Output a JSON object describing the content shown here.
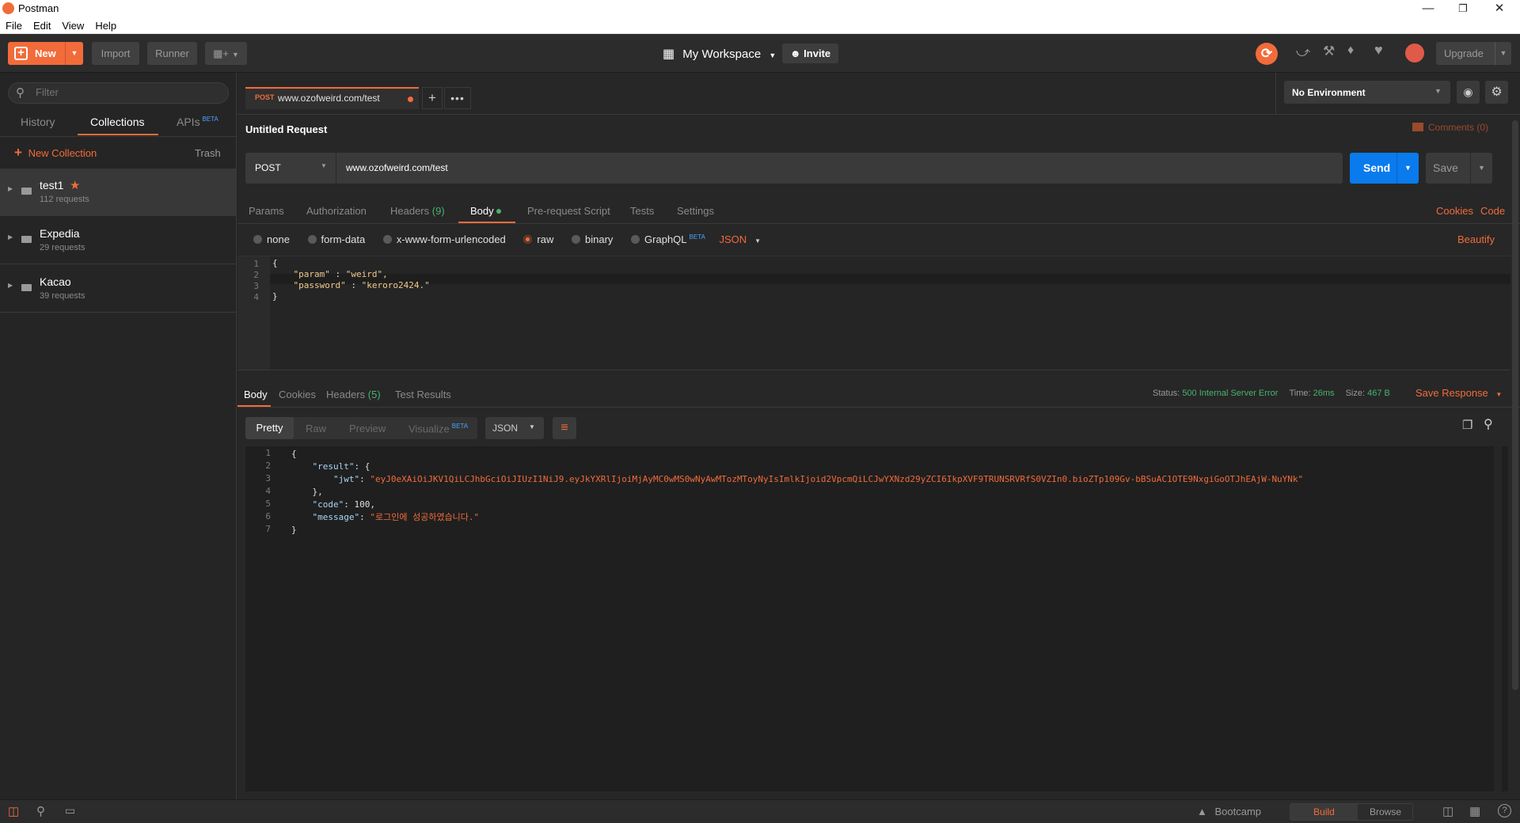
{
  "window": {
    "title": "Postman"
  },
  "menu": [
    "File",
    "Edit",
    "View",
    "Help"
  ],
  "toolbar": {
    "new_label": "New",
    "import_label": "Import",
    "runner_label": "Runner",
    "workspace_label": "My Workspace",
    "invite_label": "Invite",
    "upgrade_label": "Upgrade"
  },
  "sidebar": {
    "filter_placeholder": "Filter",
    "tabs": {
      "history": "History",
      "collections": "Collections",
      "apis": "APIs",
      "apis_badge": "BETA"
    },
    "new_collection_label": "New Collection",
    "trash_label": "Trash",
    "collections": [
      {
        "name": "test1",
        "count": "112 requests"
      },
      {
        "name": "Expedia",
        "count": "29 requests"
      },
      {
        "name": "Kacao",
        "count": "39 requests"
      }
    ]
  },
  "request_tab": {
    "method": "POST",
    "url": "www.ozofweird.com/test"
  },
  "environment": {
    "selected": "No Environment"
  },
  "request": {
    "title": "Untitled Request",
    "comments_label": "Comments (0)",
    "method": "POST",
    "url": "www.ozofweird.com/test",
    "send_label": "Send",
    "save_label": "Save",
    "tabs": {
      "params": "Params",
      "authorization": "Authorization",
      "headers": "Headers",
      "headers_count": "(9)",
      "body": "Body",
      "prerequest": "Pre-request Script",
      "tests": "Tests",
      "settings": "Settings"
    },
    "cookies_label": "Cookies",
    "code_label": "Code",
    "body_modes": {
      "none": "none",
      "form_data": "form-data",
      "urlencoded": "x-www-form-urlencoded",
      "raw": "raw",
      "binary": "binary",
      "graphql": "GraphQL",
      "graphql_badge": "BETA"
    },
    "body_format": "JSON",
    "beautify_label": "Beautify",
    "body_lines": [
      {
        "n": "1",
        "text": "{"
      },
      {
        "n": "2",
        "key": "\"param\"",
        "sep": " : ",
        "val": "\"weird\","
      },
      {
        "n": "3",
        "key": "\"password\"",
        "sep": " : ",
        "val": "\"keroro2424.\""
      },
      {
        "n": "4",
        "text": "}"
      }
    ]
  },
  "response": {
    "tabs": {
      "body": "Body",
      "cookies": "Cookies",
      "headers": "Headers",
      "headers_count": "(5)",
      "test_results": "Test Results"
    },
    "status_label": "Status:",
    "status_value": "500 Internal Server Error",
    "time_label": "Time:",
    "time_value": "26ms",
    "size_label": "Size:",
    "size_value": "467 B",
    "save_response_label": "Save Response",
    "view_modes": {
      "pretty": "Pretty",
      "raw": "Raw",
      "preview": "Preview",
      "visualize": "Visualize",
      "visualize_badge": "BETA"
    },
    "format": "JSON",
    "body_lines": [
      {
        "n": "1",
        "text": "{"
      },
      {
        "n": "2",
        "indent": "    ",
        "key": "\"result\"",
        "rest": ": {"
      },
      {
        "n": "3",
        "indent": "        ",
        "key": "\"jwt\"",
        "rest": ": ",
        "val": "\"eyJ0eXAiOiJKV1QiLCJhbGciOiJIUzI1NiJ9.eyJkYXRlIjoiMjAyMC0wMS0wNyAwMTozMToyNyIsImlkIjoid2VpcmQiLCJwYXNzd29yZCI6IkpXVF9TRUNSRVRfS0VZIn0.bioZTp109Gv-bBSuAC1OTE9NxgiGoOTJhEAjW-NuYNk\""
      },
      {
        "n": "4",
        "indent": "    ",
        "text": "},"
      },
      {
        "n": "5",
        "indent": "    ",
        "key": "\"code\"",
        "rest": ": 100,"
      },
      {
        "n": "6",
        "indent": "    ",
        "key": "\"message\"",
        "rest": ": ",
        "val": "\"로그인에 성공하였습니다.\""
      },
      {
        "n": "7",
        "text": "}"
      }
    ]
  },
  "statusbar": {
    "bootcamp_label": "Bootcamp",
    "build_label": "Build",
    "browse_label": "Browse"
  },
  "colors": {
    "accent": "#f26b3a",
    "send": "#097bed",
    "status_green": "#48b36d"
  }
}
